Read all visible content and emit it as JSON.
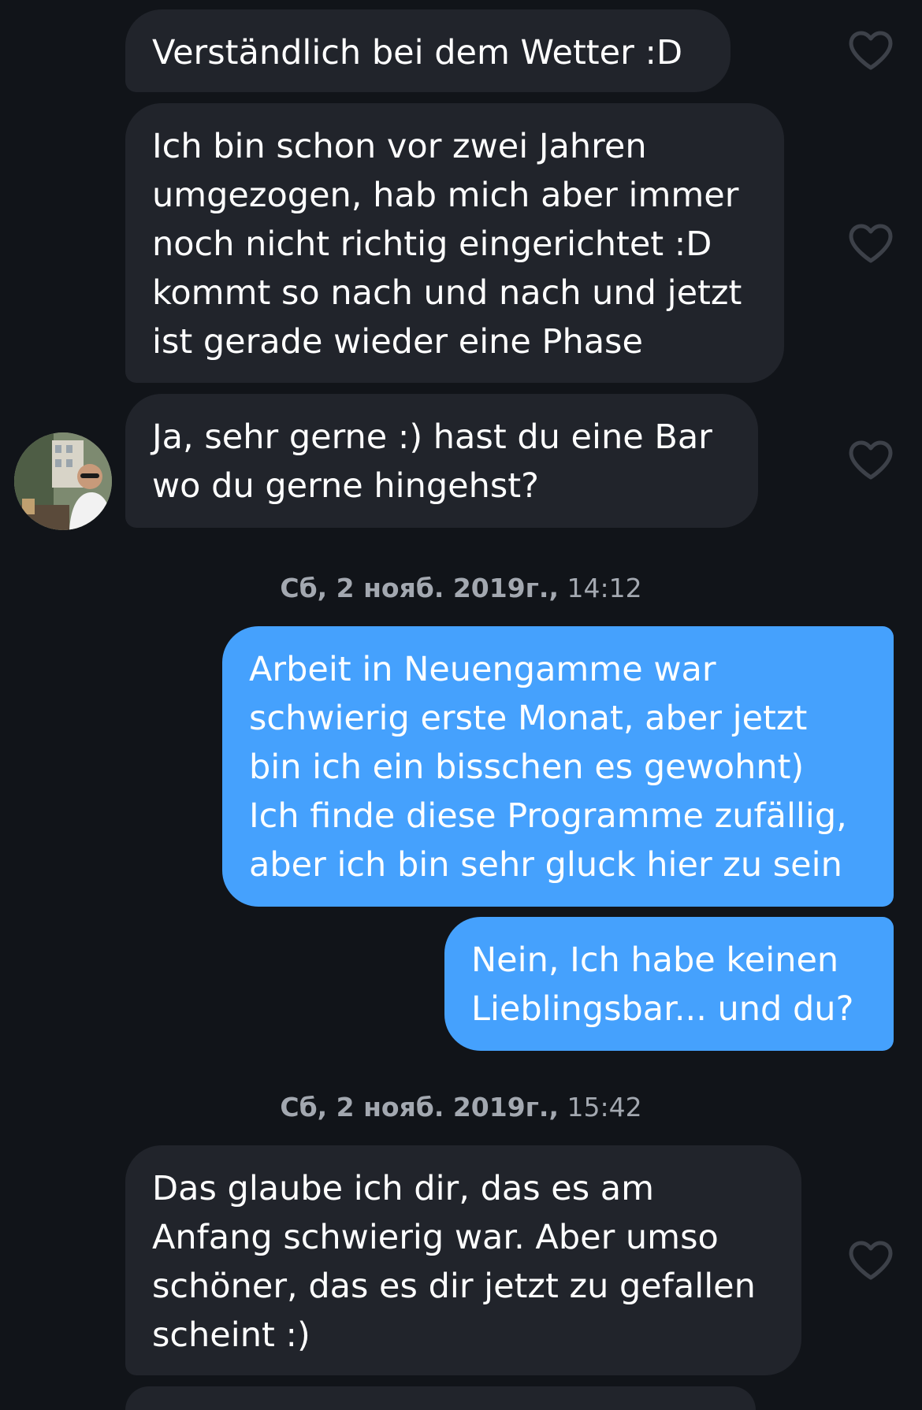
{
  "colors": {
    "background": "#111419",
    "incoming_bubble": "#21242b",
    "outgoing_bubble": "#45a1fd",
    "text": "#ffffff",
    "timestamp": "#a3a8b0",
    "heart_outline": "#3d4149"
  },
  "messages": [
    {
      "sender": "match",
      "text": "Verständlich bei dem Wetter :D",
      "liked": false,
      "icon": "heart-outline-icon"
    },
    {
      "sender": "match",
      "text": "Ich bin schon vor zwei Jahren\numgezogen, hab mich aber immer\nnoch nicht richtig eingerichtet :D\nkommt so nach und nach und jetzt\nist gerade wieder eine Phase",
      "liked": false,
      "icon": "heart-outline-icon"
    },
    {
      "sender": "match",
      "text": "Ja, sehr gerne :) hast du eine Bar\nwo du gerne hingehst?",
      "liked": false,
      "icon": "heart-outline-icon",
      "avatar": "profile-photo"
    },
    {
      "sender": "me",
      "text": "Arbeit in Neuengamme war\nschwierig erste Monat, aber jetzt\nbin ich ein bisschen es gewohnt)\nIch finde diese Programme zufällig,\naber ich bin sehr gluck hier zu sein"
    },
    {
      "sender": "me",
      "text": "Nein, Ich habe keinen\nLieblingsbar... und du?"
    },
    {
      "sender": "match",
      "text": "Das glaube ich dir, das es am\nAnfang schwierig war. Aber umso\nschöner, das es dir jetzt zu gefallen\nscheint :)",
      "liked": false,
      "icon": "heart-outline-icon"
    }
  ],
  "timestamps": [
    {
      "day": "Сб, 2 нояб. 2019г.,",
      "time": "14:12"
    },
    {
      "day": "Сб, 2 нояб. 2019г.,",
      "time": "15:42"
    }
  ]
}
